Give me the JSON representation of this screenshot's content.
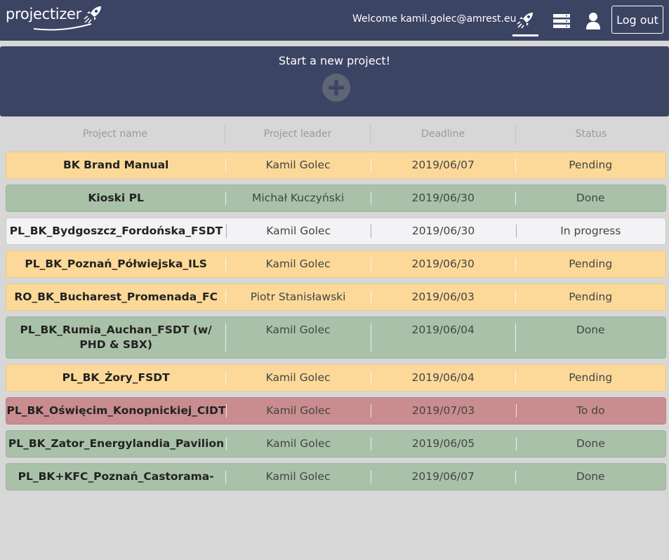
{
  "app": {
    "logo_text": "projectizer",
    "welcome": "Welcome kamil.golec@amrest.eu",
    "logout_label": "Log out",
    "nav_icons": [
      "rocket-icon",
      "list-icon",
      "user-icon"
    ]
  },
  "new_project": {
    "title": "Start a new project!",
    "add_icon": "plus-circle-icon"
  },
  "table": {
    "headers": [
      "Project name",
      "Project leader",
      "Deadline",
      "Status"
    ],
    "rows": [
      {
        "name": "BK Brand Manual",
        "leader": "Kamil Golec",
        "deadline": "2019/06/07",
        "status": "Pending",
        "kind": "pending"
      },
      {
        "name": "Kioski PL",
        "leader": "Michał Kuczyński",
        "deadline": "2019/06/30",
        "status": "Done",
        "kind": "done"
      },
      {
        "name": "PL_BK_Bydgoszcz_Fordońska_FSDT",
        "leader": "Kamil Golec",
        "deadline": "2019/06/30",
        "status": "In progress",
        "kind": "progress"
      },
      {
        "name": "PL_BK_Poznań_Półwiejska_ILS",
        "leader": "Kamil Golec",
        "deadline": "2019/06/30",
        "status": "Pending",
        "kind": "pending"
      },
      {
        "name": "RO_BK_Bucharest_Promenada_FC",
        "leader": "Piotr Stanisławski",
        "deadline": "2019/06/03",
        "status": "Pending",
        "kind": "pending"
      },
      {
        "name": "PL_BK_Rumia_Auchan_FSDT (w/ PHD & SBX)",
        "leader": "Kamil Golec",
        "deadline": "2019/06/04",
        "status": "Done",
        "kind": "done"
      },
      {
        "name": "PL_BK_Żory_FSDT",
        "leader": "Kamil Golec",
        "deadline": "2019/06/04",
        "status": "Pending",
        "kind": "pending"
      },
      {
        "name": "PL_BK_Oświęcim_Konopnickiej_CIDT",
        "leader": "Kamil Golec",
        "deadline": "2019/07/03",
        "status": "To do",
        "kind": "todo"
      },
      {
        "name": "PL_BK_Zator_Energylandia_Pavilion",
        "leader": "Kamil Golec",
        "deadline": "2019/06/05",
        "status": "Done",
        "kind": "done"
      },
      {
        "name": "PL_BK+KFC_Poznań_Castorama-",
        "leader": "Kamil Golec",
        "deadline": "2019/06/07",
        "status": "Done",
        "kind": "done"
      }
    ]
  },
  "colors": {
    "header_bg": "#3c4463",
    "page_bg": "#d7d7d7",
    "pending": "#fcd998",
    "done": "#a9c1a9",
    "in_progress": "#f3f3f5",
    "to_do": "#c98d8f"
  }
}
